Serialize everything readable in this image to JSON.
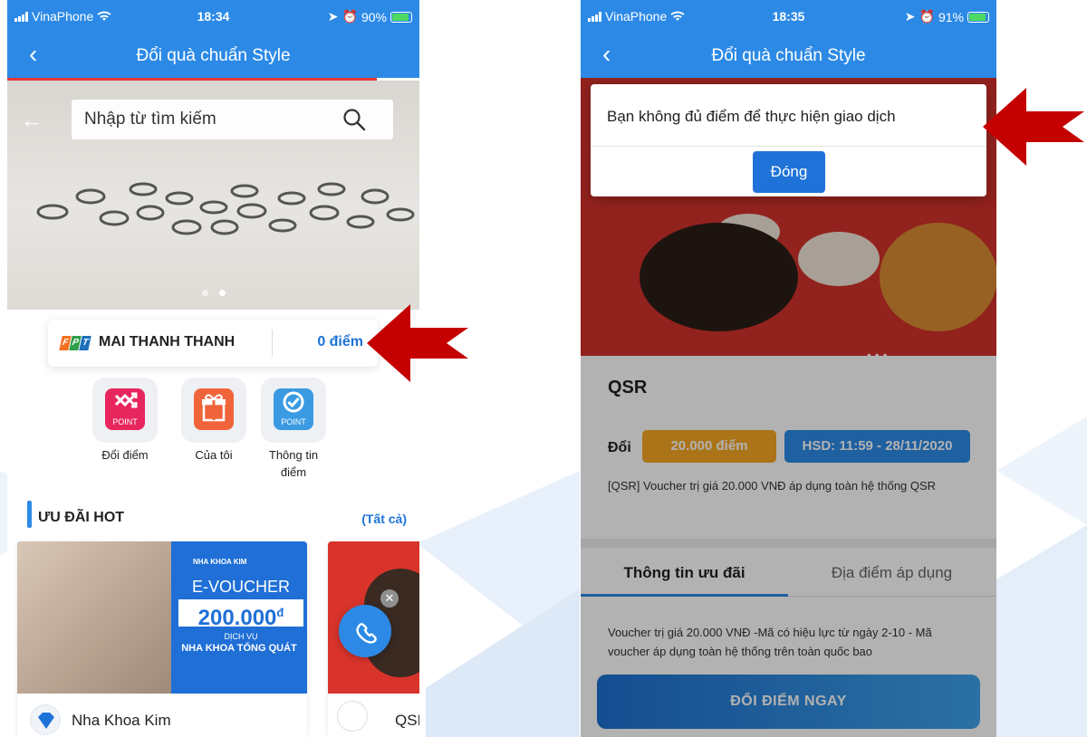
{
  "colors": {
    "header_blue": "#2c8ae6",
    "link_blue": "#1e73d9",
    "arrow_red": "#c40000",
    "price_orange": "#f5a623"
  },
  "left_screen": {
    "status_bar": {
      "carrier": "VinaPhone",
      "time": "18:34",
      "battery": "90%"
    },
    "nav": {
      "back_icon": "chevron-left-icon",
      "title": "Đổi quà chuẩn Style"
    },
    "search": {
      "placeholder": "Nhập từ tìm kiếm",
      "icon": "search-icon"
    },
    "carousel": {
      "slides": 2,
      "active_slide": 2
    },
    "member": {
      "name": "MAI THANH THANH",
      "points": "0 điểm",
      "brand": "FPT"
    },
    "actions": [
      {
        "label": "Đổi điểm",
        "icon": "shuffle-icon",
        "tag": "POINT"
      },
      {
        "label": "Của tôi",
        "icon": "gift-icon"
      },
      {
        "label": "Thông tin điểm",
        "icon": "check-badge-icon",
        "tag": "POINT"
      }
    ],
    "hot_deals": {
      "title": "ƯU ĐÃI HOT",
      "see_all": "(Tất cả)",
      "cards": [
        {
          "merchant": "Nha Khoa Kim",
          "banner_clinic": "NHA KHOA KIM",
          "banner_title": "E-VOUCHER",
          "banner_amount": "200.000",
          "banner_currency": "đ",
          "banner_service_line1": "DỊCH VỤ",
          "banner_service_line2": "NHA KHOA TỔNG QUÁT"
        },
        {
          "merchant": "QSI"
        }
      ]
    }
  },
  "right_screen": {
    "status_bar": {
      "carrier": "VinaPhone",
      "time": "18:35",
      "battery": "91%"
    },
    "nav": {
      "back_icon": "chevron-left-icon",
      "title": "Đổi quà chuẩn Style"
    },
    "product": {
      "title": "QSR",
      "exchange_label": "Đổi",
      "price": "20.000 điểm",
      "expiry": "HSD: 11:59 - 28/11/2020",
      "description": "[QSR] Voucher trị giá 20.000 VNĐ áp dụng toàn hệ thống QSR"
    },
    "tabs": [
      "Thông tin ưu đãi",
      "Địa điểm áp dụng"
    ],
    "active_tab": 0,
    "detail": "Voucher trị giá 20.000 VNĐ -Mã có hiệu lực từ ngày 2-10 - Mã voucher áp dụng toàn hệ thống trên toàn quốc bao",
    "cta": "ĐỔI ĐIỂM NGAY",
    "dialog": {
      "message": "Bạn không đủ điểm để thực hiện giao dịch",
      "button": "Đóng"
    }
  }
}
